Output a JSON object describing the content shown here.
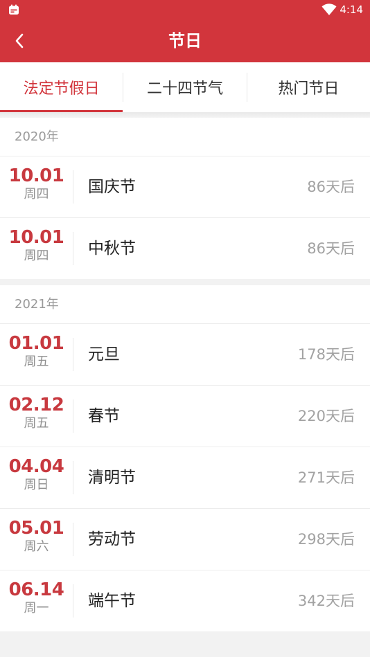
{
  "status_bar": {
    "time": "4:14",
    "app_icon": "calendar-app-icon",
    "wifi_icon": "wifi-icon"
  },
  "app_bar": {
    "title": "节日",
    "back_icon": "chevron-left-icon"
  },
  "tabs": [
    {
      "label": "法定节假日",
      "active": true
    },
    {
      "label": "二十四节气",
      "active": false
    },
    {
      "label": "热门节日",
      "active": false
    }
  ],
  "colors": {
    "accent": "#d2353c",
    "date_red": "#c8393f",
    "muted": "#9a9a9a"
  },
  "sections": [
    {
      "year_label": "2020年",
      "items": [
        {
          "date": "10.01",
          "weekday": "周四",
          "name": "国庆节",
          "countdown": "86天后"
        },
        {
          "date": "10.01",
          "weekday": "周四",
          "name": "中秋节",
          "countdown": "86天后"
        }
      ]
    },
    {
      "year_label": "2021年",
      "items": [
        {
          "date": "01.01",
          "weekday": "周五",
          "name": "元旦",
          "countdown": "178天后"
        },
        {
          "date": "02.12",
          "weekday": "周五",
          "name": "春节",
          "countdown": "220天后"
        },
        {
          "date": "04.04",
          "weekday": "周日",
          "name": "清明节",
          "countdown": "271天后"
        },
        {
          "date": "05.01",
          "weekday": "周六",
          "name": "劳动节",
          "countdown": "298天后"
        },
        {
          "date": "06.14",
          "weekday": "周一",
          "name": "端午节",
          "countdown": "342天后"
        }
      ]
    }
  ]
}
